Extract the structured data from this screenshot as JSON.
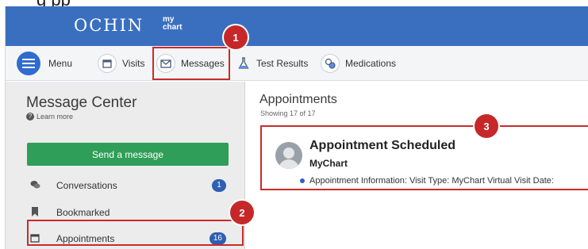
{
  "caption": "g      pp",
  "header": {
    "logo_text": "OCHIN",
    "logo_sub": "my chart"
  },
  "nav": {
    "menu_label": "Menu",
    "items": [
      {
        "label": "Visits",
        "icon": "calendar-icon"
      },
      {
        "label": "Messages",
        "icon": "envelope-icon"
      },
      {
        "label": "Test Results",
        "icon": "flask-icon"
      },
      {
        "label": "Medications",
        "icon": "pills-icon"
      }
    ]
  },
  "sidebar": {
    "title": "Message Center",
    "learn_more": "Learn more",
    "send_button": "Send a message",
    "items": [
      {
        "label": "Conversations",
        "count": "1",
        "icon": "chat-icon"
      },
      {
        "label": "Bookmarked",
        "count": "",
        "icon": "bookmark-icon"
      },
      {
        "label": "Appointments",
        "count": "16",
        "icon": "calendar-icon"
      }
    ]
  },
  "main": {
    "title": "Appointments",
    "showing": "Showing 17 of 17",
    "message": {
      "title": "Appointment Scheduled",
      "from": "MyChart",
      "preview": "Appointment Information: Visit Type: MyChart Virtual Visit Date:"
    }
  },
  "annotations": [
    "1",
    "2",
    "3"
  ],
  "colors": {
    "header": "#3a6fc0",
    "send_button": "#2f9e58",
    "badge": "#c6282a",
    "count_pill": "#2e5fb3"
  }
}
